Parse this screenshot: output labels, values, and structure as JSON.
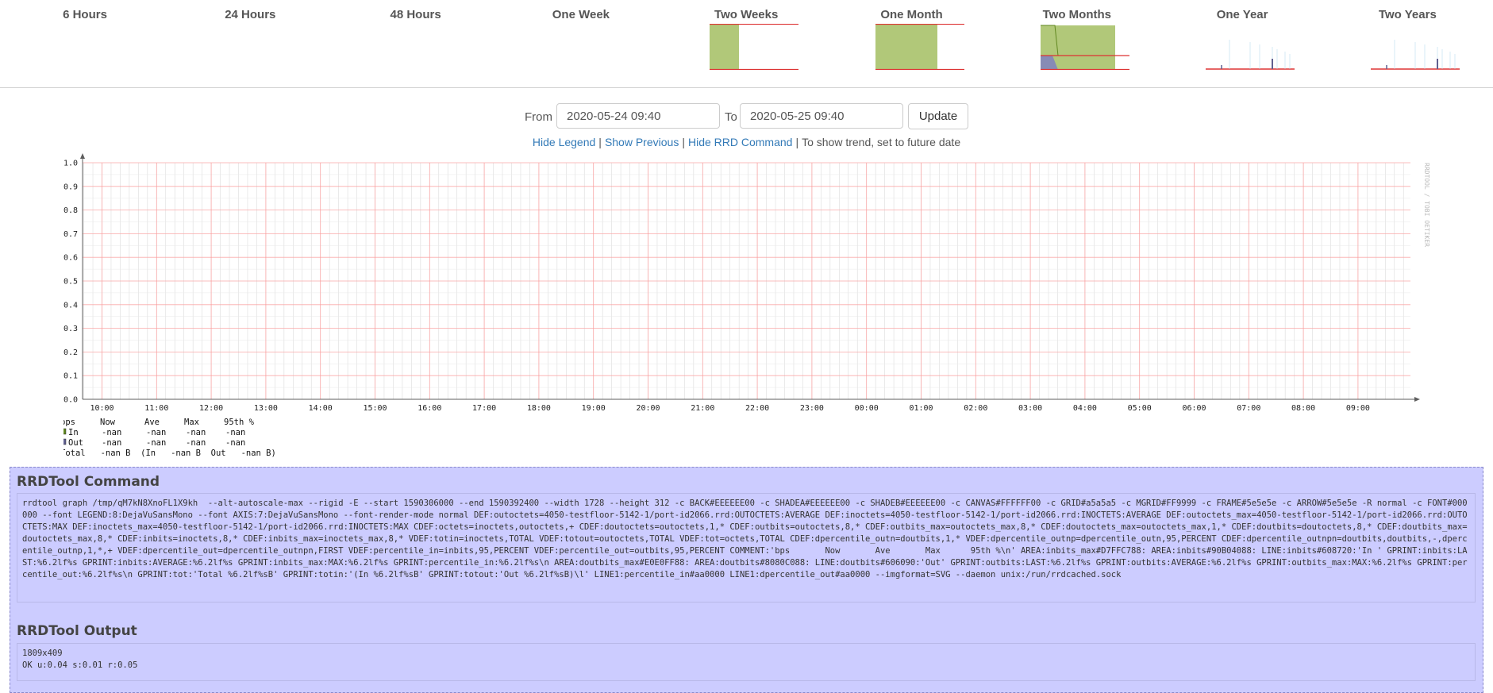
{
  "periods": [
    {
      "label": "6 Hours",
      "thumb": "none"
    },
    {
      "label": "24 Hours",
      "thumb": "none"
    },
    {
      "label": "48 Hours",
      "thumb": "none"
    },
    {
      "label": "One Week",
      "thumb": "none"
    },
    {
      "label": "Two Weeks",
      "thumb": "green-block"
    },
    {
      "label": "One Month",
      "thumb": "green-block-wide"
    },
    {
      "label": "Two Months",
      "thumb": "green-blue-drop"
    },
    {
      "label": "One Year",
      "thumb": "spikes"
    },
    {
      "label": "Two Years",
      "thumb": "spikes"
    }
  ],
  "form": {
    "from_label": "From",
    "from_value": "2020-05-24 09:40",
    "to_label": "To",
    "to_value": "2020-05-25 09:40",
    "update_label": "Update"
  },
  "links": {
    "hide_legend": "Hide Legend",
    "show_previous": "Show Previous",
    "hide_rrd": "Hide RRD Command",
    "trend_note": "To show trend, set to future date"
  },
  "colors": {
    "in_area": "#90B040",
    "in_line": "#608720",
    "out_area": "#8080C0",
    "out_line": "#606090",
    "grid": "#a5a5a5",
    "mgrid": "#FF9999",
    "frame": "#5e5e5e",
    "panel": "#ccccff"
  },
  "chart_data": {
    "type": "line",
    "title": "",
    "xlabel": "",
    "ylabel": "",
    "ylim": [
      0,
      1.0
    ],
    "yticks": [
      "0.0",
      "0.1",
      "0.2",
      "0.3",
      "0.4",
      "0.5",
      "0.6",
      "0.7",
      "0.8",
      "0.9",
      "1.0"
    ],
    "xticks": [
      "10:00",
      "11:00",
      "12:00",
      "13:00",
      "14:00",
      "15:00",
      "16:00",
      "17:00",
      "18:00",
      "19:00",
      "20:00",
      "21:00",
      "22:00",
      "23:00",
      "00:00",
      "01:00",
      "02:00",
      "03:00",
      "04:00",
      "05:00",
      "06:00",
      "07:00",
      "08:00",
      "09:00"
    ],
    "grid": true,
    "series": [
      {
        "name": "In",
        "values": []
      },
      {
        "name": "Out",
        "values": []
      }
    ],
    "watermark": "RRDTOOL / TOBI OETIKER"
  },
  "legend": {
    "header": [
      "bps",
      "Now",
      "Ave",
      "Max",
      "95th %"
    ],
    "rows": [
      {
        "name": "In",
        "values": [
          "-nan",
          "-nan",
          "-nan",
          "-nan"
        ]
      },
      {
        "name": "Out",
        "values": [
          "-nan",
          "-nan",
          "-nan",
          "-nan"
        ]
      }
    ],
    "total_line": "Total   -nan B  (In   -nan B  Out   -nan B)"
  },
  "rrd": {
    "command_title": "RRDTool Command",
    "command": "rrdtool graph /tmp/qM7kN8XnoFL1X9kh  --alt-autoscale-max --rigid -E --start 1590306000 --end 1590392400 --width 1728 --height 312 -c BACK#EEEEEE00 -c SHADEA#EEEEEE00 -c SHADEB#EEEEEE00 -c CANVAS#FFFFFF00 -c GRID#a5a5a5 -c MGRID#FF9999 -c FRAME#5e5e5e -c ARROW#5e5e5e -R normal -c FONT#000000 --font LEGEND:8:DejaVuSansMono --font AXIS:7:DejaVuSansMono --font-render-mode normal DEF:outoctets=4050-testfloor-5142-1/port-id2066.rrd:OUTOCTETS:AVERAGE DEF:inoctets=4050-testfloor-5142-1/port-id2066.rrd:INOCTETS:AVERAGE DEF:outoctets_max=4050-testfloor-5142-1/port-id2066.rrd:OUTOCTETS:MAX DEF:inoctets_max=4050-testfloor-5142-1/port-id2066.rrd:INOCTETS:MAX CDEF:octets=inoctets,outoctets,+ CDEF:doutoctets=outoctets,1,* CDEF:outbits=outoctets,8,* CDEF:outbits_max=outoctets_max,8,* CDEF:doutoctets_max=outoctets_max,1,* CDEF:doutbits=doutoctets,8,* CDEF:doutbits_max=doutoctets_max,8,* CDEF:inbits=inoctets,8,* CDEF:inbits_max=inoctets_max,8,* VDEF:totin=inoctets,TOTAL VDEF:totout=outoctets,TOTAL VDEF:tot=octets,TOTAL CDEF:dpercentile_outn=doutbits,1,* VDEF:dpercentile_outnp=dpercentile_outn,95,PERCENT CDEF:dpercentile_outnpn=doutbits,doutbits,-,dpercentile_outnp,1,*,+ VDEF:dpercentile_out=dpercentile_outnpn,FIRST VDEF:percentile_in=inbits,95,PERCENT VDEF:percentile_out=outbits,95,PERCENT COMMENT:'bps       Now       Ave       Max      95th %\\n' AREA:inbits_max#D7FFC788: AREA:inbits#90B04088: LINE:inbits#608720:'In ' GPRINT:inbits:LAST:%6.2lf%s GPRINT:inbits:AVERAGE:%6.2lf%s GPRINT:inbits_max:MAX:%6.2lf%s GPRINT:percentile_in:%6.2lf%s\\n AREA:doutbits_max#E0E0FF88: AREA:doutbits#8080C088: LINE:doutbits#606090:'Out' GPRINT:outbits:LAST:%6.2lf%s GPRINT:outbits:AVERAGE:%6.2lf%s GPRINT:outbits_max:MAX:%6.2lf%s GPRINT:percentile_out:%6.2lf%s\\n GPRINT:tot:'Total %6.2lf%sB' GPRINT:totin:'(In %6.2lf%sB' GPRINT:totout:'Out %6.2lf%sB)\\l' LINE1:percentile_in#aa0000 LINE1:dpercentile_out#aa0000 --imgformat=SVG --daemon unix:/run/rrdcached.sock",
    "output_title": "RRDTool Output",
    "output_lines": "1809x409\nOK u:0.04 s:0.01 r:0.05"
  }
}
